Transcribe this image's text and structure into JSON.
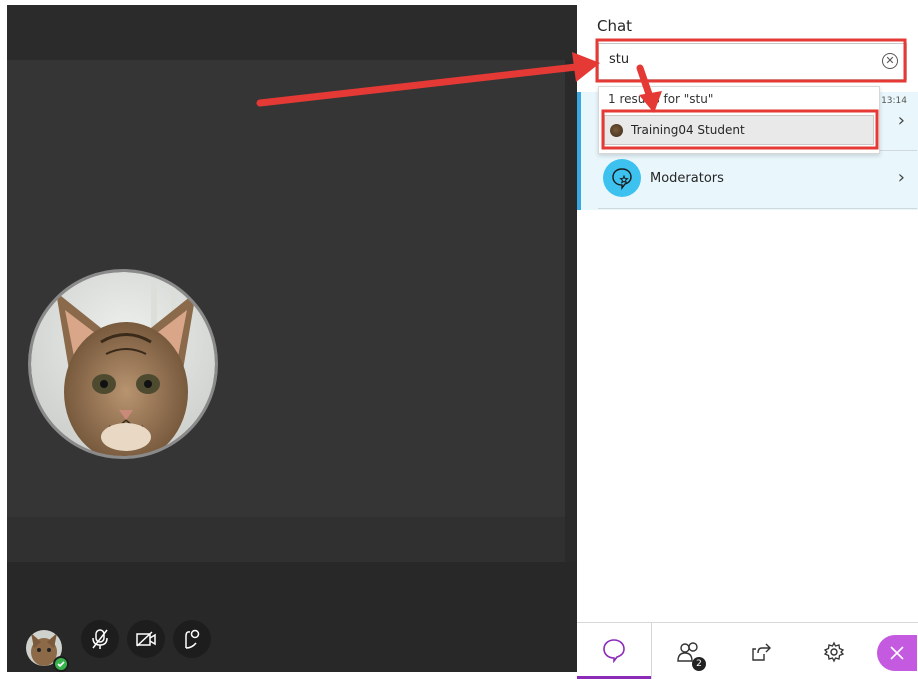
{
  "chat": {
    "title": "Chat",
    "search_value": "stu",
    "results_text": "1 results for \"stu\"",
    "result_name": "Training04 Student",
    "conversations": [
      {
        "name": "Training04 Student",
        "time": "13:14"
      },
      {
        "name": "Moderators"
      }
    ]
  },
  "nav": {
    "attendee_count": "2"
  },
  "colors": {
    "accent_purple": "#8b2bb8",
    "collapse_pink": "#c35adf",
    "chat_highlight_blue": "#3aa8e0",
    "moderators_icon": "#3dc2ef",
    "annotation_red": "#e53935"
  }
}
